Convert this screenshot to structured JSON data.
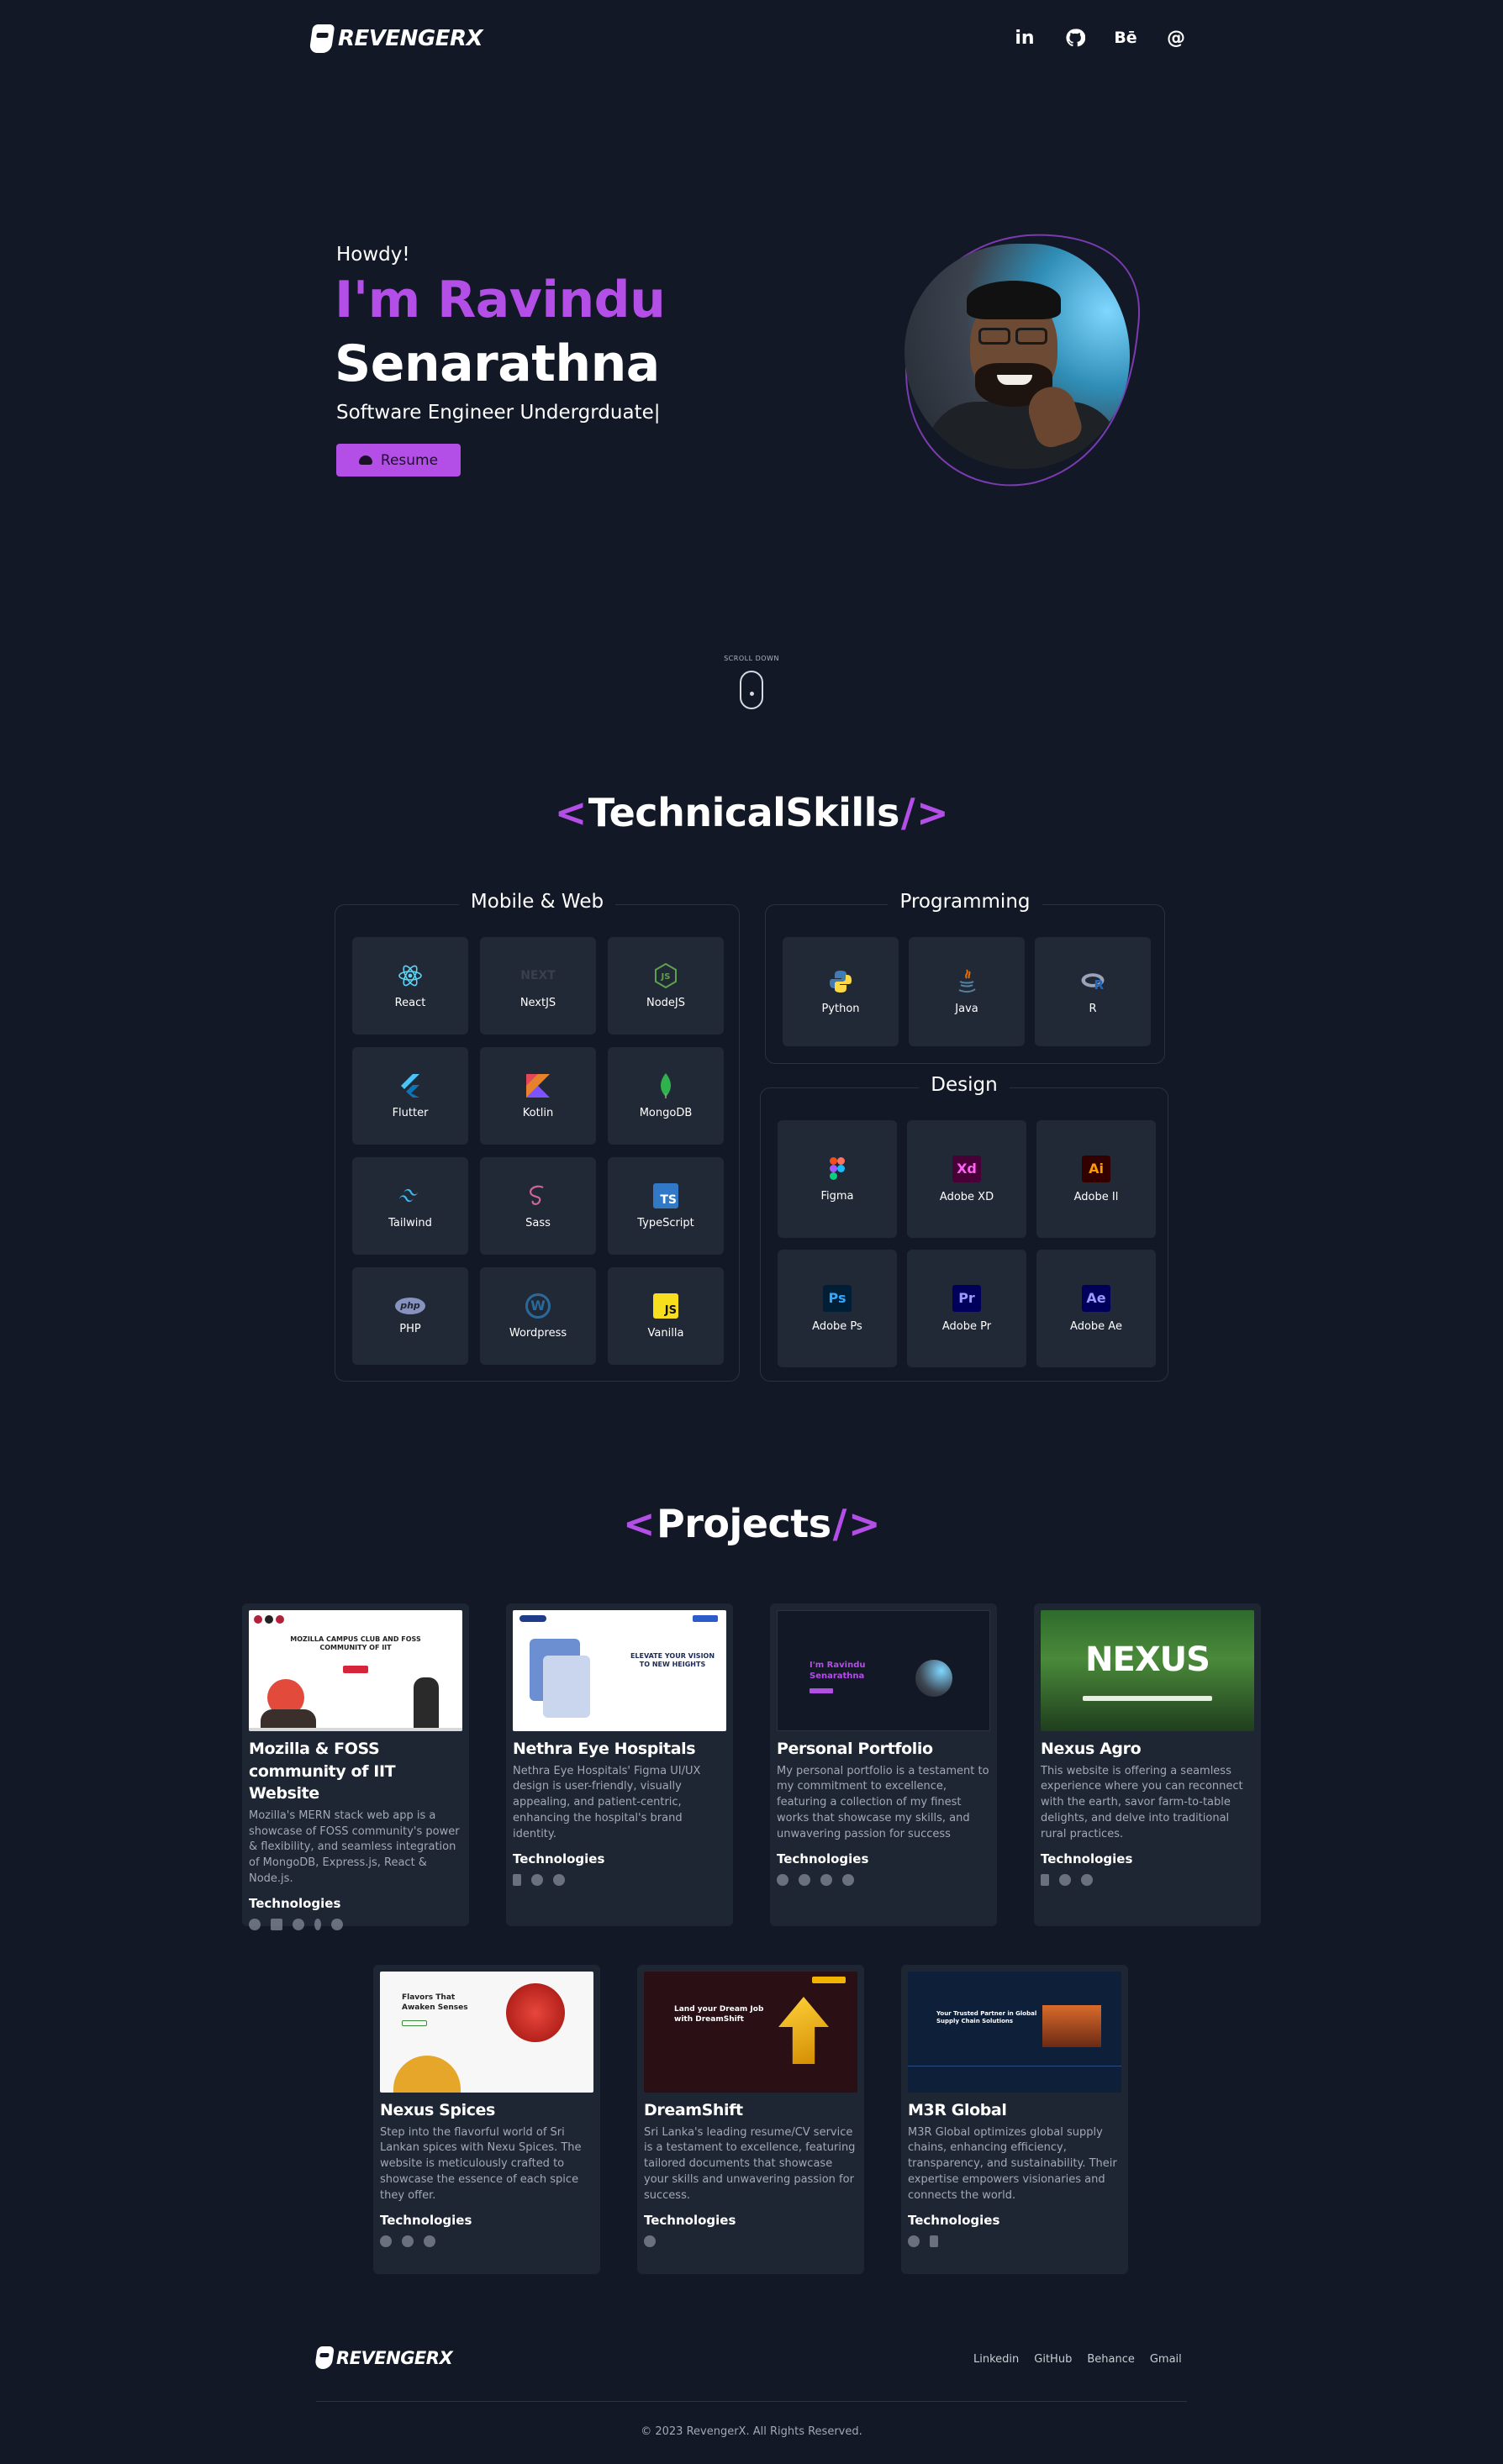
{
  "brand": {
    "logo_text": "REVENGERX"
  },
  "nav": {
    "icons": [
      {
        "name": "linkedin-icon",
        "glyph": "in"
      },
      {
        "name": "github-icon",
        "glyph": ""
      },
      {
        "name": "behance-icon",
        "glyph": "Bē"
      },
      {
        "name": "email-icon",
        "glyph": "@"
      }
    ]
  },
  "hero": {
    "greeting": "Howdy!",
    "line1": "I'm Ravindu",
    "line2": "Senarathna",
    "role": "Software Engineer Undergrduate|",
    "resume_label": "Resume",
    "accent_color": "#b34ee6"
  },
  "scroll": {
    "label": "SCROLL DOWN"
  },
  "skills": {
    "title_left": "<",
    "title_text": "TechnicalSkills",
    "title_slash": "/",
    "title_right": ">",
    "groups": {
      "web": {
        "title": "Mobile & Web",
        "items": [
          {
            "label": "React",
            "icon": "react-icon"
          },
          {
            "label": "NextJS",
            "icon": "nextjs-icon"
          },
          {
            "label": "NodeJS",
            "icon": "nodejs-icon"
          },
          {
            "label": "Flutter",
            "icon": "flutter-icon"
          },
          {
            "label": "Kotlin",
            "icon": "kotlin-icon"
          },
          {
            "label": "MongoDB",
            "icon": "mongodb-icon"
          },
          {
            "label": "Tailwind",
            "icon": "tailwind-icon"
          },
          {
            "label": "Sass",
            "icon": "sass-icon"
          },
          {
            "label": "TypeScript",
            "icon": "typescript-icon"
          },
          {
            "label": "PHP",
            "icon": "php-icon"
          },
          {
            "label": "Wordpress",
            "icon": "wordpress-icon"
          },
          {
            "label": "Vanilla",
            "icon": "javascript-icon"
          }
        ]
      },
      "programming": {
        "title": "Programming",
        "items": [
          {
            "label": "Python",
            "icon": "python-icon"
          },
          {
            "label": "Java",
            "icon": "java-icon"
          },
          {
            "label": "R",
            "icon": "r-icon"
          }
        ]
      },
      "design": {
        "title": "Design",
        "items": [
          {
            "label": "Figma",
            "icon": "figma-icon"
          },
          {
            "label": "Adobe XD",
            "icon": "adobe-xd-icon",
            "glyph": "Xd"
          },
          {
            "label": "Adobe Il",
            "icon": "adobe-illustrator-icon",
            "glyph": "Ai"
          },
          {
            "label": "Adobe Ps",
            "icon": "adobe-photoshop-icon",
            "glyph": "Ps"
          },
          {
            "label": "Adobe Pr",
            "icon": "adobe-premiere-icon",
            "glyph": "Pr"
          },
          {
            "label": "Adobe Ae",
            "icon": "adobe-after-effects-icon",
            "glyph": "Ae"
          }
        ]
      }
    }
  },
  "projects": {
    "title_left": "<",
    "title_text": "Projects",
    "title_slash": "/",
    "title_right": ">",
    "technologies_label": "Technologies",
    "cards": [
      {
        "title": "Mozilla & FOSS community of IIT Website",
        "desc": "Mozilla's MERN stack web app is a showcase of FOSS community's power & flexibility, and seamless integration of MongoDB, Express.js, React & Node.js.",
        "shot_heading": "MOZILLA CAMPUS CLUB AND FOSS COMMUNITY OF IIT"
      },
      {
        "title": "Nethra Eye Hospitals",
        "desc": "Nethra Eye Hospitals' Figma UI/UX design is user-friendly, visually appealing, and patient-centric, enhancing the hospital's brand identity.",
        "shot_heading": "ELEVATE YOUR VISION TO NEW HEIGHTS"
      },
      {
        "title": "Personal Portfolio",
        "desc": "My personal portfolio is a testament to my commitment to excellence, featuring a collection of my finest works that showcase my skills, and unwavering passion for success",
        "shot_heading": "I'm Ravindu Senarathna"
      },
      {
        "title": "Nexus Agro",
        "desc": "This website is offering a seamless experience where you can reconnect with the earth, savor farm-to-table delights, and delve into traditional rural practices.",
        "shot_heading": "NEXUS"
      },
      {
        "title": "Nexus Spices",
        "desc": "Step into the flavorful world of Sri Lankan spices with Nexu Spices. The website is meticulously crafted to showcase the essence of each spice they offer.",
        "shot_heading": "Flavors That Awaken Senses"
      },
      {
        "title": "DreamShift",
        "desc": "Sri Lanka's leading resume/CV service is a testament to excellence, featuring tailored documents that showcase your skills and unwavering passion for success.",
        "shot_heading": "Land your Dream Job with DreamShift"
      },
      {
        "title": "M3R Global",
        "desc": "M3R Global optimizes global supply chains, enhancing efficiency, transparency, and sustainability. Their expertise empowers visionaries and connects the world.",
        "shot_heading": "Your Trusted Partner in Global Supply Chain Solutions"
      }
    ]
  },
  "footer": {
    "logo_text": "REVENGERX",
    "links": [
      "Linkedin",
      "GitHub",
      "Behance",
      "Gmail"
    ],
    "copyright": "© 2023 RevengerX. All Rights Reserved."
  }
}
